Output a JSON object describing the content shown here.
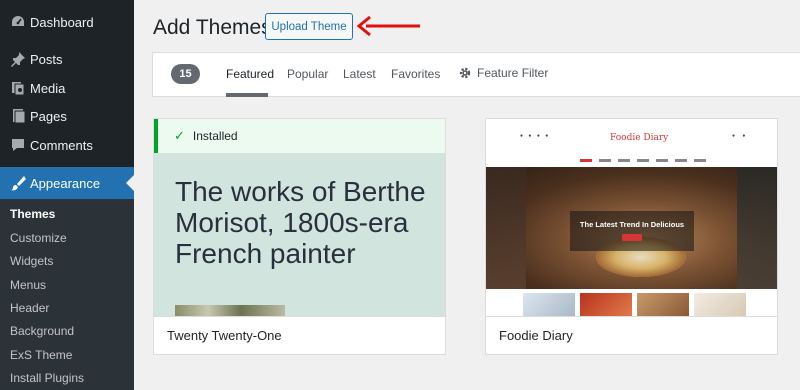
{
  "sidebar": {
    "items": [
      {
        "label": "Dashboard",
        "icon": "dashboard-icon"
      },
      {
        "label": "Posts",
        "icon": "pushpin-icon"
      },
      {
        "label": "Media",
        "icon": "media-icon"
      },
      {
        "label": "Pages",
        "icon": "pages-icon"
      },
      {
        "label": "Comments",
        "icon": "comment-icon"
      },
      {
        "label": "Appearance",
        "icon": "paintbrush-icon"
      }
    ],
    "submenu": [
      "Themes",
      "Customize",
      "Widgets",
      "Menus",
      "Header",
      "Background",
      "ExS Theme",
      "Install Plugins"
    ]
  },
  "header": {
    "title": "Add Themes",
    "upload_button": "Upload Theme"
  },
  "filter_bar": {
    "count": "15",
    "tabs": [
      "Featured",
      "Popular",
      "Latest",
      "Favorites"
    ],
    "feature_filter": "Feature Filter"
  },
  "themes": [
    {
      "name": "Twenty Twenty-One",
      "installed_label": "Installed",
      "preview_text": "The works of Berthe Morisot, 1800s-era French painter"
    },
    {
      "name": "Foodie Diary",
      "preview_logo": "Foodie Diary",
      "preview_hero": "The Latest Trend In Delicious"
    }
  ],
  "colors": {
    "sidebar_bg": "#1d2327",
    "active": "#2271b1",
    "installed_accent": "#00a32a",
    "annotation_arrow": "#e01010"
  }
}
